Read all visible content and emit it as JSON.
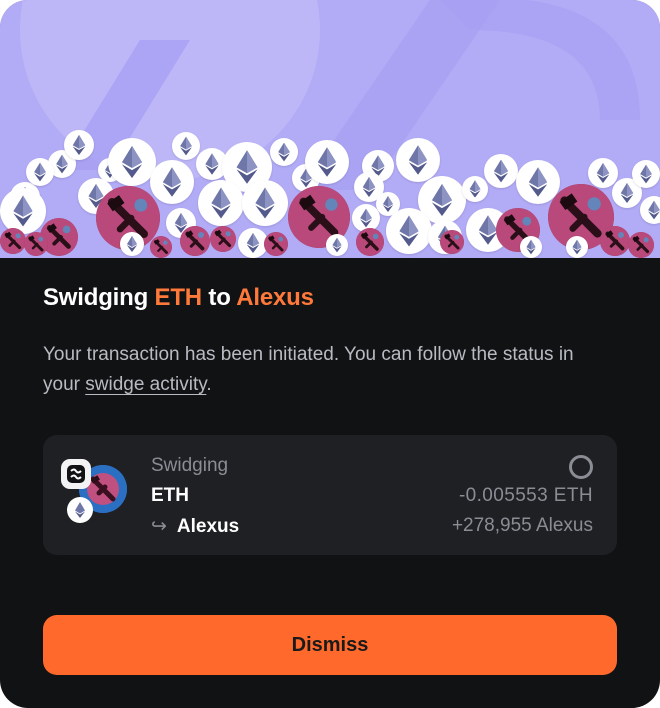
{
  "modal": {
    "title_prefix": "Swidging",
    "title_from": "ETH",
    "title_mid": "to",
    "title_to": "Alexus",
    "description_before": "Your transaction has been initiated. You can follow the status in your ",
    "description_link": "swidge activity",
    "description_after": "."
  },
  "transaction": {
    "status": "Swidging",
    "from_token": "ETH",
    "to_arrow": "↪",
    "to_token": "Alexus",
    "from_amount": "-0.005553 ETH",
    "to_amount": "+278,955 Alexus"
  },
  "actions": {
    "dismiss_label": "Dismiss"
  },
  "colors": {
    "accent": "#ff7a3a",
    "button": "#ff6a2c",
    "background": "#111214",
    "card": "#1e2024",
    "hero": "#b2abf6"
  },
  "icons": {
    "hero": [
      "eth-coin-icon",
      "alexus-token-icon"
    ],
    "card": [
      "swidge-logo-icon",
      "alexus-token-icon",
      "eth-icon",
      "spinner-icon"
    ]
  }
}
